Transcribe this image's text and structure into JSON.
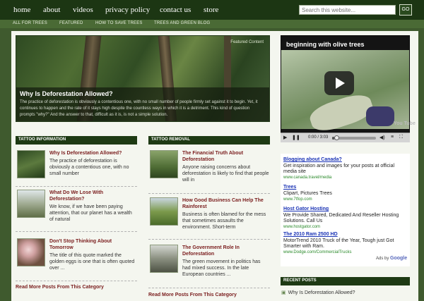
{
  "nav": {
    "items": [
      "home",
      "about",
      "videos",
      "privacy policy",
      "contact us",
      "store"
    ]
  },
  "search": {
    "placeholder": "Search this website...",
    "button_label": "GO"
  },
  "subnav": {
    "items": [
      "ALL FOR TREES",
      "FEATURED",
      "HOW TO SAVE TREES",
      "TREES AND GREEN BLOG"
    ]
  },
  "featured": {
    "credit": "Featured Content",
    "title": "Why Is Deforestation Allowed?",
    "excerpt": "The practice of deforestation is obviously a contentious one, with no small number of people firmly set against it to begin. Yet, it continues to happen and the rate of it stays high despite the countless ways in which it is a detriment. This kind of question prompts \"why?\" And the answer to that, difficult as it is, is not a simple solution."
  },
  "video": {
    "title": "beginning with olive trees",
    "time": "0:00 / 3:03",
    "progress_fraction": 0.05,
    "logo": "You Tube"
  },
  "columns": [
    {
      "header": "TATTOO INFORMATION",
      "posts": [
        {
          "title": "Why Is Deforestation Allowed?",
          "excerpt": "The practice of deforestation is obviously a contentious one, with no small number"
        },
        {
          "title": "What Do We Lose With Deforestation?",
          "excerpt": "We know, if we have been paying attention, that our planet has a wealth of natural"
        },
        {
          "title": "Don't Stop Thinking About Tomorrow",
          "excerpt": "The title of this quote marked the golden eggs is one that is often quoted over ..."
        }
      ],
      "read_more": "Read More Posts From This Category"
    },
    {
      "header": "TATTOO REMOVAL",
      "posts": [
        {
          "title": "The Financial Truth About Deforestation",
          "excerpt": "Anyone raising concerns about deforestation is likely to find that people will in"
        },
        {
          "title": "How Good Business Can Help The Rainforest",
          "excerpt": "Business is often blamed for the mess that sometimes assaults the environment. Short-term"
        },
        {
          "title": "The Government Role In Deforestation",
          "excerpt": "The green movement in politics has had mixed success. In the late European countries ..."
        }
      ],
      "read_more": "Read More Posts From This Category"
    }
  ],
  "ads": [
    {
      "title": "Blogging about Canada?",
      "text": "Get inspiration and images for your posts at official media site",
      "url": "www.canada.travel/media"
    },
    {
      "title": "Trees",
      "text": "Clipart, Pictures Trees",
      "url": "www.7tfop.com"
    },
    {
      "title": "Host Gator Hosting",
      "text": "We Provide Shared, Dedicated And Reseller Hosting Solutions. Call Us",
      "url": "www.hostgator.com"
    },
    {
      "title": "The 2010 Ram 2500 HD",
      "text": "MotorTrend 2010 Truck of the Year, Tough just Got Smarter with Ram.",
      "url": "www.Dodge.com/CommercialTrucks"
    }
  ],
  "ads_by": {
    "prefix": "Ads by",
    "brand": "Google"
  },
  "recent": {
    "header": "RECENT POSTS",
    "items": [
      "Why Is Deforestation Allowed?"
    ]
  },
  "colors": {
    "nav_bg": "#1c3613",
    "page_bg": "#3f5a2e",
    "post_title": "#7a1d1d",
    "ad_link": "#1a33b5"
  }
}
